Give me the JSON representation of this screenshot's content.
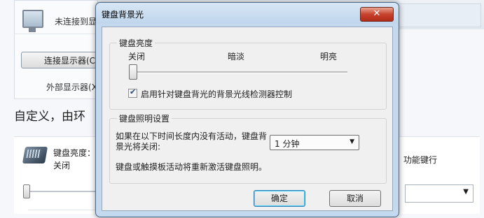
{
  "background": {
    "display_status": "未连接到显",
    "connect_button": "连接显示器(C",
    "external_display": "外部显示器(X",
    "heading": "自定义，由环",
    "keyboard_brightness_label": "键盘亮度：",
    "keyboard_brightness_value": "关闭",
    "function_row_label": "功能键行"
  },
  "dialog": {
    "title": "键盘背景光",
    "close_glyph": "✕",
    "brightness_group": {
      "title": "键盘亮度",
      "off_label": "关闭",
      "dim_label": "暗淡",
      "bright_label": "明亮",
      "slider_level": 0,
      "checkbox_label": "启用针对键盘背光的背景光线检测器控制",
      "checkbox_checked": true
    },
    "illumination_group": {
      "title": "键盘照明设置",
      "idle_label_line1": "如果在以下时间长度内没有活动，键盘背",
      "idle_label_line2": "景光将关闭:",
      "idle_select_value": "1 分钟",
      "reactivate_text": "键盘或触摸板活动将重新激活键盘照明。"
    },
    "ok_label": "确定",
    "cancel_label": "取消"
  }
}
